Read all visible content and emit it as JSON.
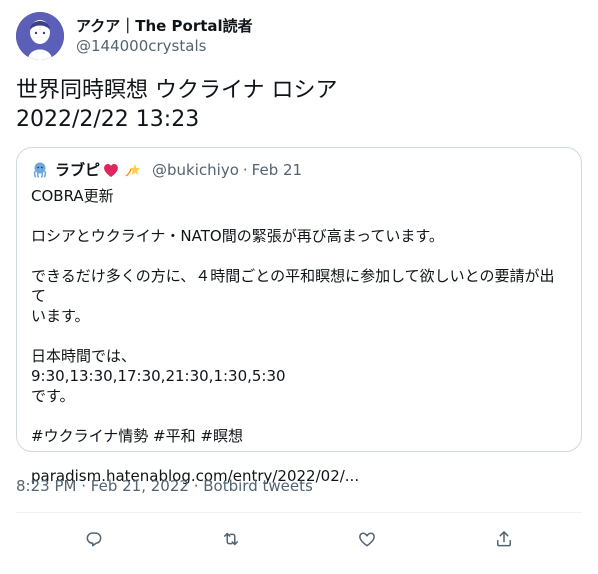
{
  "author": {
    "display_name": "アクア｜The Portal読者",
    "handle": "@144000crystals"
  },
  "tweet": {
    "text_line1": "世界同時瞑想 ウクライナ ロシア",
    "text_line2": "2022/2/22 13:23"
  },
  "quote": {
    "name": "ラブピ",
    "handle": "@bukichiyo",
    "separator": "·",
    "date": "Feb 21",
    "lines": [
      "COBRA更新",
      "",
      "ロシアとウクライナ・NATO間の緊張が再び高まっています。",
      "",
      "できるだけ多くの方に、４時間ごとの平和瞑想に参加して欲しいとの要請が出て",
      "います。",
      "",
      "日本時間では、",
      "9:30,13:30,17:30,21:30,1:30,5:30",
      "です。",
      "",
      "#ウクライナ情勢 #平和 #瞑想",
      "",
      " paradism.hatenablog.com/entry/2022/02/..."
    ]
  },
  "meta": {
    "time": "8:23 PM",
    "sep1": "·",
    "date": "Feb 21, 2022",
    "sep2": "·",
    "source": "Botbird tweets"
  },
  "icons": {
    "reply": "reply-icon",
    "retweet": "retweet-icon",
    "like": "heart-icon",
    "share": "share-icon"
  },
  "colors": {
    "text": "#0f1419",
    "secondary": "#536471",
    "border": "#cfd9de",
    "avatar_bg": "#5b5fb7"
  }
}
